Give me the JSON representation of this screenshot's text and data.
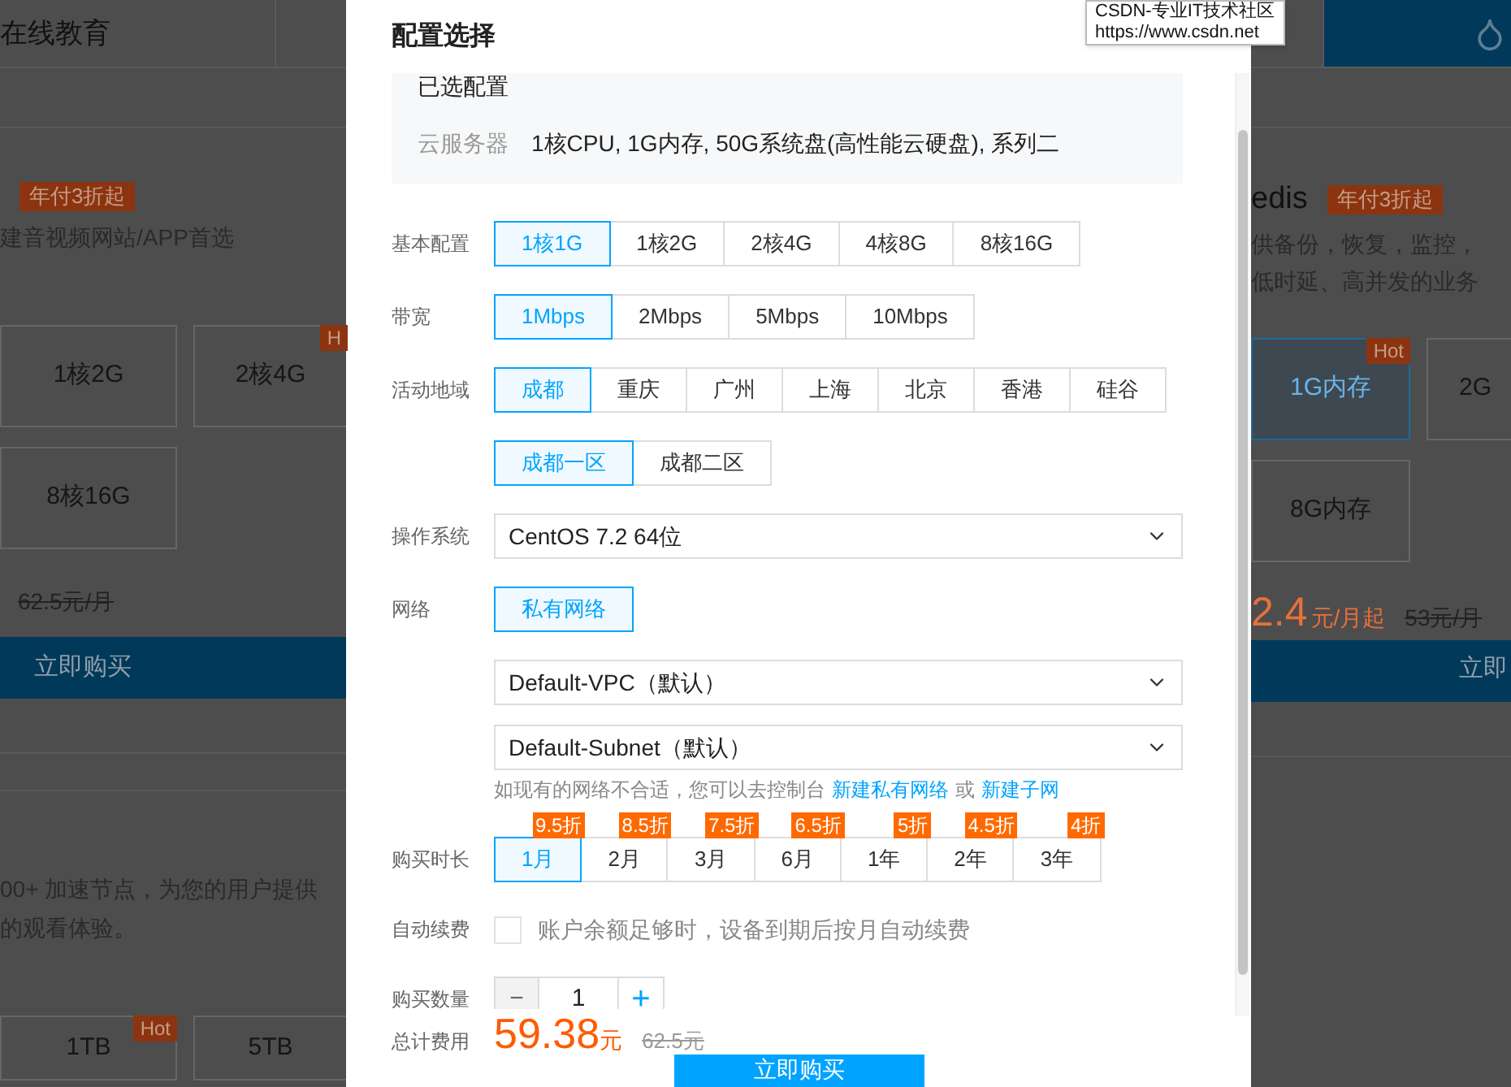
{
  "background_page": {
    "left": {
      "tab": "在线教育",
      "badge": "年付3折起",
      "description": "建音视频网站/APP首选",
      "cards": [
        {
          "label": "1核2G",
          "selected": false
        },
        {
          "label": "2核4G",
          "badge": "H",
          "selected": false
        },
        {
          "label": "8核16G",
          "selected": false
        }
      ],
      "old_price": "62.5元/月",
      "buy_button": "立即购买",
      "description_2": [
        "00+ 加速节点，为您的用户提供",
        "的观看体验。"
      ],
      "storage_cards": [
        {
          "label": "1TB",
          "badge": "Hot"
        },
        {
          "label": "5TB"
        }
      ]
    },
    "right": {
      "title": "edis",
      "badge": "年付3折起",
      "description": [
        "供备份，恢复，监控，",
        "低时延、高并发的业务"
      ],
      "cards": [
        {
          "label": "1G内存",
          "badge": "Hot",
          "selected": true
        },
        {
          "label": "2G",
          "selected": false
        },
        {
          "label": "8G内存",
          "selected": false
        }
      ],
      "price": "2.4",
      "price_unit": "元/月起",
      "old_price": "53元/月",
      "buy_button": "立即"
    }
  },
  "tooltip": {
    "lines": [
      "CSDN-专业IT技术社区",
      "https://www.csdn.net"
    ]
  },
  "dialog": {
    "title": "配置选择",
    "summary": {
      "heading": "已选配置",
      "label": "云服务器",
      "value": "1核CPU, 1G内存, 50G系统盘(高性能云硬盘), 系列二"
    },
    "rows": [
      {
        "kind": "options",
        "label": "基本配置",
        "options": [
          {
            "label": "1核1G",
            "selected": true
          },
          {
            "label": "1核2G",
            "selected": false
          },
          {
            "label": "2核4G",
            "selected": false
          },
          {
            "label": "4核8G",
            "selected": false
          },
          {
            "label": "8核16G",
            "selected": false
          }
        ]
      },
      {
        "kind": "options",
        "label": "带宽",
        "options": [
          {
            "label": "1Mbps",
            "selected": true
          },
          {
            "label": "2Mbps",
            "selected": false
          },
          {
            "label": "5Mbps",
            "selected": false
          },
          {
            "label": "10Mbps",
            "selected": false
          }
        ]
      },
      {
        "kind": "options",
        "label": "活动地域",
        "options": [
          {
            "label": "成都",
            "selected": true
          },
          {
            "label": "重庆",
            "selected": false
          },
          {
            "label": "广州",
            "selected": false
          },
          {
            "label": "上海",
            "selected": false
          },
          {
            "label": "北京",
            "selected": false
          },
          {
            "label": "香港",
            "selected": false
          },
          {
            "label": "硅谷",
            "selected": false
          }
        ]
      },
      {
        "kind": "options",
        "options": [
          {
            "label": "成都一区",
            "selected": true
          },
          {
            "label": "成都二区",
            "selected": false
          }
        ]
      },
      {
        "kind": "select",
        "label": "操作系统",
        "value": "CentOS 7.2 64位"
      },
      {
        "kind": "options",
        "label": "网络",
        "options": [
          {
            "label": "私有网络",
            "selected": true
          }
        ]
      },
      {
        "kind": "select",
        "value": "Default-VPC（默认）"
      },
      {
        "kind": "select",
        "value": "Default-Subnet（默认）"
      },
      {
        "kind": "hint",
        "text": "如现有的网络不合适，您可以去控制台",
        "links": [
          "新建私有网络",
          "新建子网"
        ],
        "joiner": "或"
      },
      {
        "kind": "options",
        "label": "购买时长",
        "options": [
          {
            "label": "1月",
            "badge": "9.5折",
            "selected": true
          },
          {
            "label": "2月",
            "badge": "8.5折",
            "selected": false
          },
          {
            "label": "3月",
            "badge": "7.5折",
            "selected": false
          },
          {
            "label": "6月",
            "badge": "6.5折",
            "selected": false
          },
          {
            "label": "1年",
            "badge": "5折",
            "selected": false
          },
          {
            "label": "2年",
            "badge": "4.5折",
            "selected": false
          },
          {
            "label": "3年",
            "badge": "4折",
            "selected": false
          }
        ]
      },
      {
        "kind": "checkbox",
        "label": "自动续费",
        "text": "账户余额足够时，设备到期后按月自动续费",
        "checked": false
      },
      {
        "kind": "stepper",
        "label": "购买数量",
        "minus": "−",
        "value": "1",
        "plus": "+"
      }
    ],
    "footer": {
      "label": "总计费用",
      "price": "59.38",
      "unit": "元",
      "old_price": "62.5元",
      "button": "立即购买"
    }
  }
}
